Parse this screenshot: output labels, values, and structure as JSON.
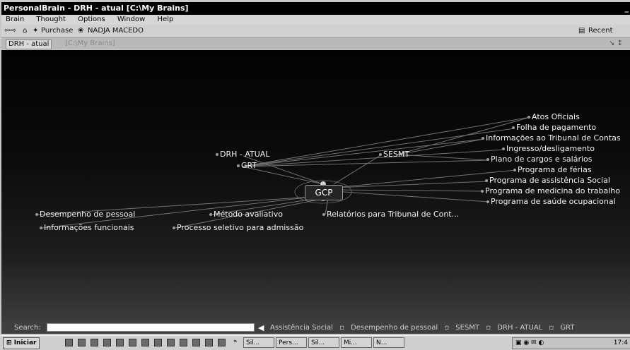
{
  "window": {
    "title": "PersonalBrain - DRH - atual [C:\\My Brains]",
    "minimize_glyph": "_"
  },
  "menu": [
    "Brain",
    "Thought",
    "Options",
    "Window",
    "Help"
  ],
  "toolbar": {
    "favorites_label": "Purchase",
    "user_label": "NADJA MACEDO",
    "recent_label": "Recent"
  },
  "pathbar": {
    "brain_label": "DRH - atual",
    "path": "[C:\\My Brains]",
    "right_glyph": "↘ ↕"
  },
  "brain": {
    "central": "GCP",
    "parents": [
      "DRH - ATUAL",
      "GRT"
    ],
    "jump": "SESMT",
    "jump_children": [
      "Atos Oficiais",
      "Folha de pagamento",
      "Informações ao Tribunal de Contas",
      "Ingresso/desligamento",
      "Plano de cargos e salários",
      "Programa de férias",
      "Programa de assistência Social",
      "Programa de medicina do trabalho",
      "Programa de saúde ocupacional"
    ],
    "children": [
      "Desempenho de pessoal",
      "Informações funcionais",
      "Método avaliativo",
      "Processo seletivo para admissão",
      "Relatórios para Tribunal de Cont..."
    ]
  },
  "search": {
    "label": "Search:",
    "value": "",
    "back_glyph": "◀",
    "pins": [
      "Assistência Social",
      "Desempenho de pessoal",
      "SESMT",
      "DRH - ATUAL",
      "GRT"
    ]
  },
  "taskbar": {
    "start_label": "Iniciar",
    "buttons": [
      "Sil...",
      "Pers...",
      "Sil...",
      "Mi...",
      "N..."
    ],
    "clock": "17:4"
  },
  "colors": {
    "canvas_top": "#030303",
    "canvas_bottom": "#3c3c3c",
    "link_line": "#8a8a8a",
    "node_text": "#f2f2f2"
  }
}
